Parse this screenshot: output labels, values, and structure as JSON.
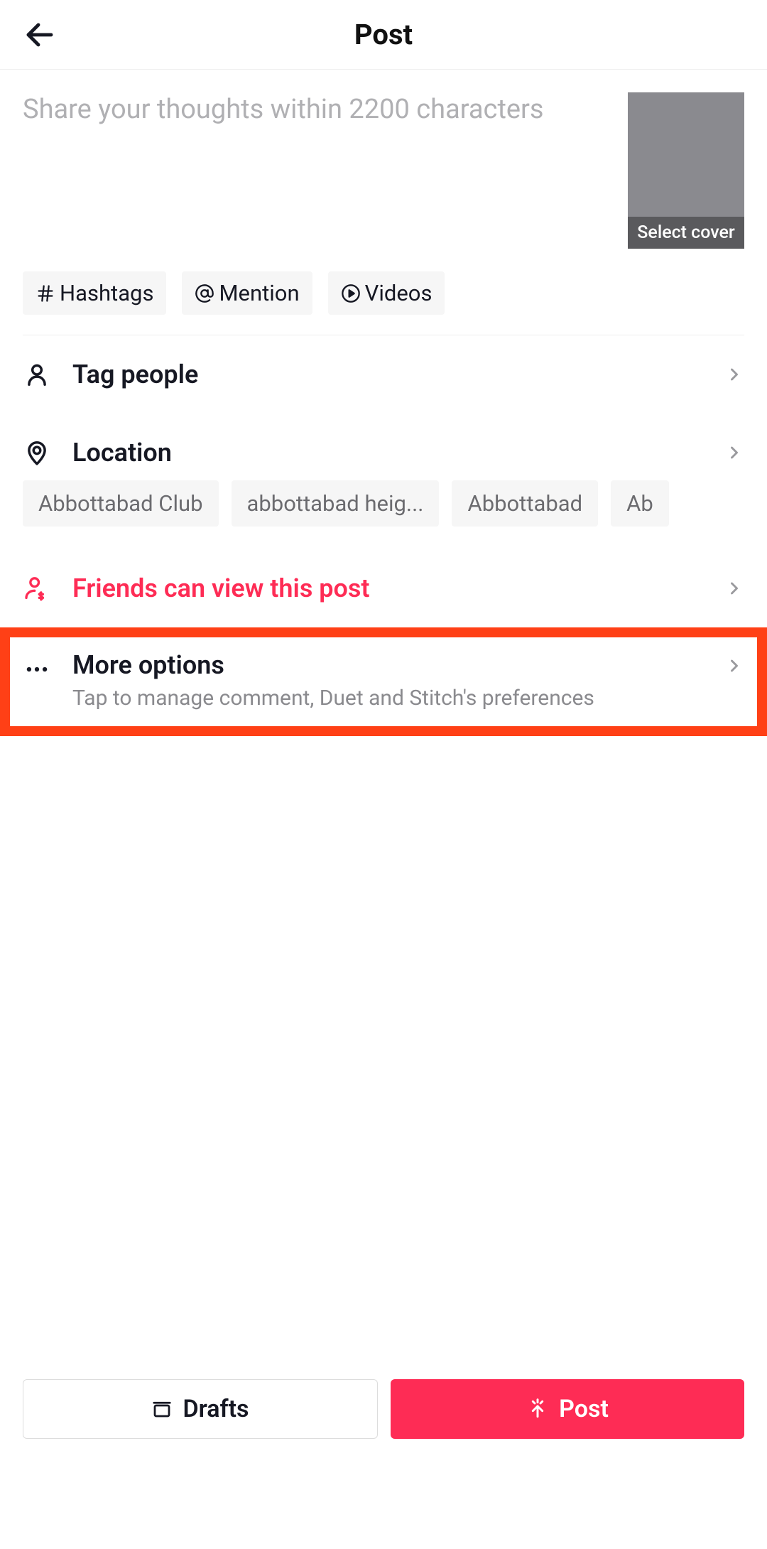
{
  "header": {
    "title": "Post"
  },
  "compose": {
    "placeholder": "Share your thoughts within 2200 characters",
    "cover_label": "Select cover"
  },
  "chips": {
    "hashtags": "Hashtags",
    "mention": "Mention",
    "videos": "Videos"
  },
  "options": {
    "tag_people": "Tag people",
    "location": "Location",
    "privacy": "Friends can view this post",
    "more": {
      "title": "More options",
      "subtitle": "Tap to manage comment, Duet and Stitch's preferences"
    }
  },
  "location_suggestions": [
    "Abbottabad Club",
    "abbottabad heig...",
    "Abbottabad",
    "Ab"
  ],
  "buttons": {
    "drafts": "Drafts",
    "post": "Post"
  }
}
